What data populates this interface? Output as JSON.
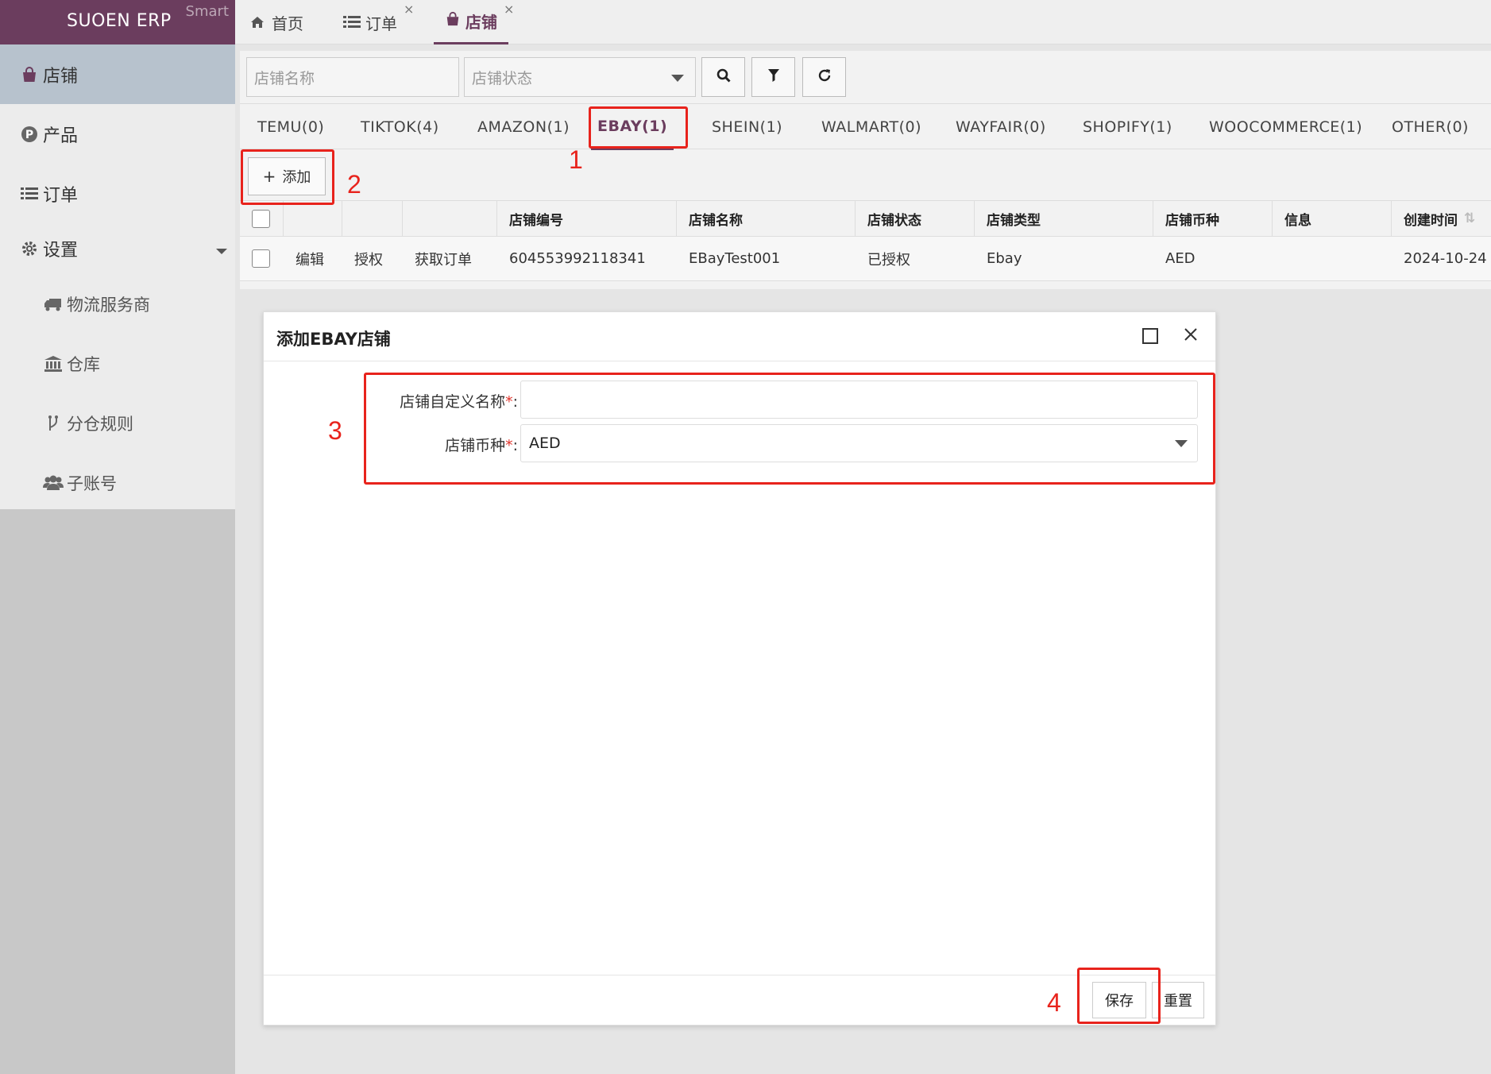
{
  "brand": {
    "name": "SUOEN ERP",
    "edition": "Smart"
  },
  "sidebar": {
    "items": [
      {
        "label": "店铺",
        "icon": "shopping-bag-icon"
      },
      {
        "label": "产品",
        "icon": "product-p-icon"
      },
      {
        "label": "订单",
        "icon": "list-icon"
      },
      {
        "label": "设置",
        "icon": "gear-icon"
      },
      {
        "label": "物流服务商",
        "icon": "truck-icon"
      },
      {
        "label": "仓库",
        "icon": "warehouse-icon"
      },
      {
        "label": "分仓规则",
        "icon": "branch-icon"
      },
      {
        "label": "子账号",
        "icon": "users-icon"
      }
    ]
  },
  "top_tabs": [
    {
      "label": "首页",
      "icon": "home-icon"
    },
    {
      "label": "订单",
      "icon": "list-icon",
      "close": "×"
    },
    {
      "label": "店铺",
      "icon": "shopping-bag-icon",
      "close": "×"
    }
  ],
  "search": {
    "name_placeholder": "店铺名称",
    "status_placeholder": "店铺状态"
  },
  "platform_tabs": [
    "TEMU(0)",
    "TIKTOK(4)",
    "AMAZON(1)",
    "EBAY(1)",
    "SHEIN(1)",
    "WALMART(0)",
    "WAYFAIR(0)",
    "SHOPIFY(1)",
    "WOOCOMMERCE(1)",
    "OTHER(0)"
  ],
  "toolbar": {
    "add_label": "添加",
    "add_icon": "+"
  },
  "table": {
    "columns": [
      "店铺编号",
      "店铺名称",
      "店铺状态",
      "店铺类型",
      "店铺币种",
      "信息",
      "创建时间"
    ],
    "sort_icon": "⇅",
    "rows": [
      {
        "actions": [
          "编辑",
          "授权",
          "获取订单"
        ],
        "store_id": "604553992118341",
        "store_name": "EBayTest001",
        "status": "已授权",
        "type": "Ebay",
        "currency": "AED",
        "info": "",
        "created": "2024-10-24"
      }
    ]
  },
  "dialog": {
    "title": "添加EBAY店铺",
    "fields": [
      {
        "label": "店铺自定义名称",
        "required": "*",
        "value": ""
      },
      {
        "label": "店铺币种",
        "required": "*",
        "value": "AED"
      }
    ],
    "colon": ":",
    "save_label": "保存",
    "reset_label": "重置"
  },
  "annotations": [
    "1",
    "2",
    "3",
    "4"
  ],
  "colors": {
    "brand": "#6b3d5e",
    "annotation": "#e8231c",
    "required": "#e0332b"
  }
}
